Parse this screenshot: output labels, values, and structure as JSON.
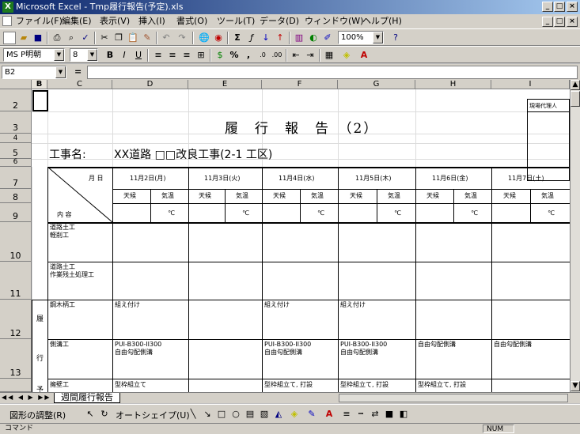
{
  "window": {
    "title": "Microsoft Excel - Tmp履行報告(予定).xls"
  },
  "menu": [
    "ファイル(F)",
    "編集(E)",
    "表示(V)",
    "挿入(I)",
    "書式(O)",
    "ツール(T)",
    "データ(D)",
    "ウィンドウ(W)",
    "ヘルプ(H)"
  ],
  "toolbar": {
    "zoom": "100%"
  },
  "format": {
    "font": "MS P明朝",
    "size": "8"
  },
  "formula": {
    "namebox": "B2",
    "eq": "=",
    "value": ""
  },
  "columns": [
    "B",
    "C",
    "D",
    "E",
    "F",
    "G",
    "H",
    "I"
  ],
  "rows": [
    "2",
    "3",
    "4",
    "5",
    "6",
    "7",
    "8",
    "9",
    "10",
    "11",
    "12",
    "13"
  ],
  "sheet": {
    "title": "履　行　報　告　（2）",
    "corner_label": "現場代理人",
    "project_label": "工事名:",
    "project_name": "XX道路  □□改良工事(2-1 工区)",
    "month_day": "月 日",
    "content": "内 容",
    "dates": [
      "11月2日(月)",
      "11月3日(火)",
      "11月4日(水)",
      "11月5日(木)",
      "11月6日(金)",
      "11月7日(土)"
    ],
    "weather": "天候",
    "temp": "気温",
    "deg": "℃",
    "r10": [
      "道路土工",
      "軽削工"
    ],
    "r11": [
      "道路土工",
      "作業残土処理工"
    ],
    "r12_label": "鋼木柄工",
    "r12_vals": [
      "組え付け",
      "組え付け",
      "組え付け"
    ],
    "side_top": "履",
    "side_mid": "行",
    "side_bot": "予",
    "r13_label": "側溝工",
    "r13_vals": [
      [
        "PUI-B300-II300",
        "自由勾配側溝"
      ],
      [
        "PUI-B300-II300",
        "自由勾配側溝"
      ],
      [
        "PUI-B300-II300",
        "自由勾配側溝"
      ],
      [
        "自由勾配側溝",
        ""
      ],
      [
        "自由勾配側溝",
        ""
      ]
    ],
    "r14_label": "擁壁工",
    "r14_vals": [
      "型枠組立て",
      "型枠組立て, 打設",
      "型枠組立て, 打設",
      "型枠組立て, 打設"
    ]
  },
  "sheet_tab": "週間履行報告",
  "drawing": {
    "adjust": "図形の調整(R)",
    "autoshape": "オートシェイプ(U)"
  },
  "status": {
    "left": "コマンド",
    "num": "NUM"
  }
}
